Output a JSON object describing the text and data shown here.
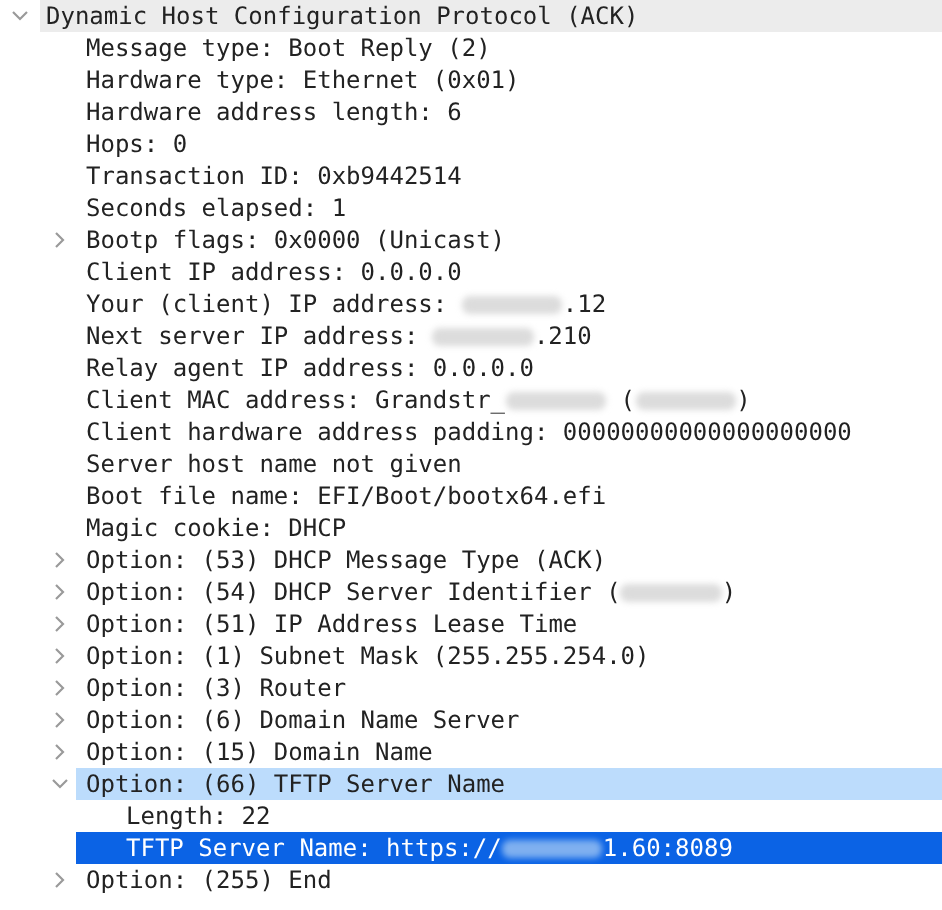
{
  "tree": [
    {
      "label": "Dynamic Host Configuration Protocol (ACK)",
      "expanded": true,
      "shaded": true,
      "selected": false,
      "children": [
        {
          "label": "Message type: Boot Reply (2)",
          "selected": false
        },
        {
          "label": "Hardware type: Ethernet (0x01)",
          "selected": false
        },
        {
          "label": "Hardware address length: 6",
          "selected": false
        },
        {
          "label": "Hops: 0",
          "selected": false
        },
        {
          "label": "Transaction ID: 0xb9442514",
          "selected": false
        },
        {
          "label": "Seconds elapsed: 1",
          "selected": false
        },
        {
          "label": "Bootp flags: 0x0000 (Unicast)",
          "expanded": false,
          "selected": false
        },
        {
          "label": "Client IP address: 0.0.0.0",
          "selected": false
        },
        {
          "segments": [
            {
              "kind": "text",
              "text": "Your (client) IP address: "
            },
            {
              "kind": "redacted"
            },
            {
              "kind": "text",
              "text": ".12"
            }
          ],
          "selected": false
        },
        {
          "segments": [
            {
              "kind": "text",
              "text": "Next server IP address: "
            },
            {
              "kind": "redacted"
            },
            {
              "kind": "text",
              "text": ".210"
            }
          ],
          "selected": false
        },
        {
          "label": "Relay agent IP address: 0.0.0.0",
          "selected": false
        },
        {
          "segments": [
            {
              "kind": "text",
              "text": "Client MAC address: Grandstr_"
            },
            {
              "kind": "redacted"
            },
            {
              "kind": "text",
              "text": " ("
            },
            {
              "kind": "redacted"
            },
            {
              "kind": "text",
              "text": ")"
            }
          ],
          "selected": false
        },
        {
          "label": "Client hardware address padding: 00000000000000000000",
          "selected": false
        },
        {
          "label": "Server host name not given",
          "selected": false
        },
        {
          "label": "Boot file name: EFI/Boot/bootx64.efi",
          "selected": false
        },
        {
          "label": "Magic cookie: DHCP",
          "selected": false
        },
        {
          "label": "Option: (53) DHCP Message Type (ACK)",
          "expanded": false,
          "selected": false
        },
        {
          "segments": [
            {
              "kind": "text",
              "text": "Option: (54) DHCP Server Identifier ("
            },
            {
              "kind": "redacted"
            },
            {
              "kind": "text",
              "text": ")"
            }
          ],
          "expanded": false,
          "selected": false
        },
        {
          "label": "Option: (51) IP Address Lease Time",
          "expanded": false,
          "selected": false
        },
        {
          "label": "Option: (1) Subnet Mask (255.255.254.0)",
          "expanded": false,
          "selected": false
        },
        {
          "label": "Option: (3) Router",
          "expanded": false,
          "selected": false
        },
        {
          "label": "Option: (6) Domain Name Server",
          "expanded": false,
          "selected": false
        },
        {
          "label": "Option: (15) Domain Name",
          "expanded": false,
          "selected": false
        },
        {
          "label": "Option: (66) TFTP Server Name",
          "expanded": true,
          "selected": false,
          "children": [
            {
              "label": "Length: 22",
              "selected": false
            },
            {
              "segments": [
                {
                  "kind": "text",
                  "text": "TFTP Server Name: https://"
                },
                {
                  "kind": "redacted"
                },
                {
                  "kind": "text",
                  "text": "1.60:8089"
                }
              ],
              "selected": true
            }
          ]
        },
        {
          "label": "Option: (255) End",
          "expanded": false,
          "selected": false
        }
      ]
    }
  ]
}
